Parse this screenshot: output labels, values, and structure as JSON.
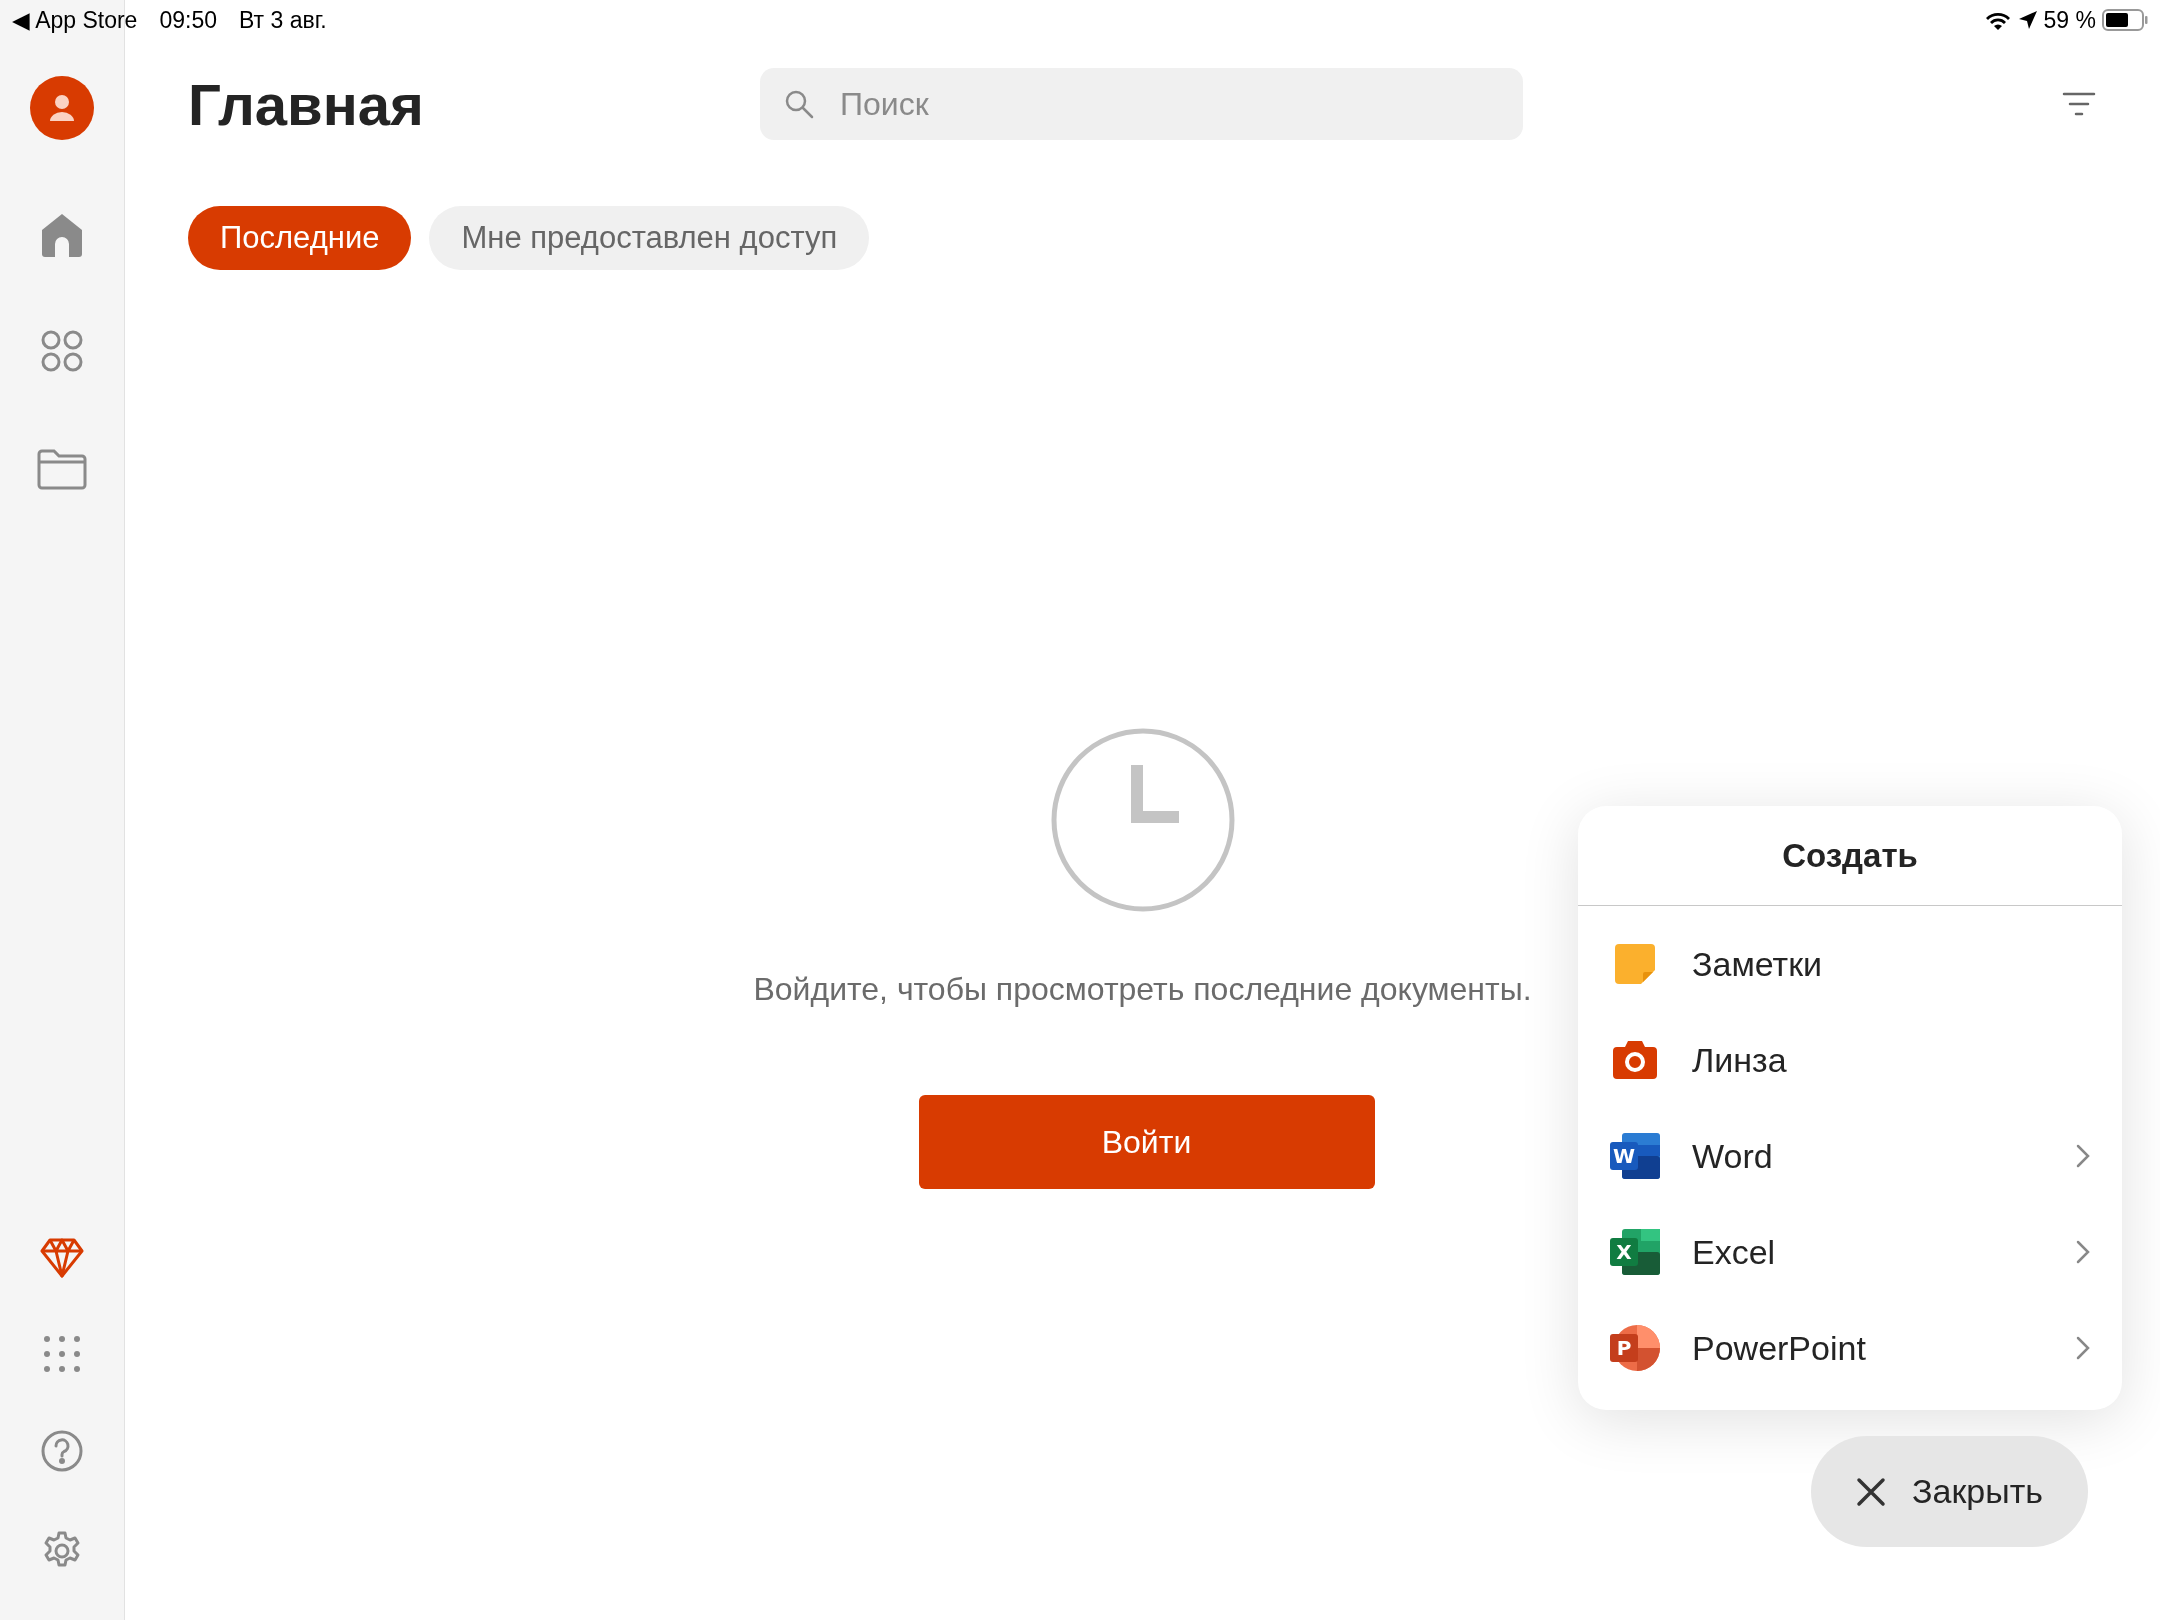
{
  "status_bar": {
    "back_arrow": "◀",
    "back_app": "App Store",
    "time": "09:50",
    "date": "Вт 3 авг.",
    "battery_percent": "59 %"
  },
  "header": {
    "title": "Главная",
    "search": {
      "placeholder": "Поиск"
    }
  },
  "tabs": [
    {
      "label": "Последние",
      "selected": true
    },
    {
      "label": "Мне предоставлен доступ",
      "selected": false
    }
  ],
  "empty_state": {
    "message": "Войдите, чтобы просмотреть последние документы.",
    "button": "Войти"
  },
  "create_menu": {
    "title": "Создать",
    "items": [
      {
        "kind": "notes",
        "label": "Заметки",
        "submenu": false
      },
      {
        "kind": "lens",
        "label": "Линза",
        "submenu": false
      },
      {
        "kind": "word",
        "icon_letter": "W",
        "label": "Word",
        "submenu": true
      },
      {
        "kind": "excel",
        "icon_letter": "X",
        "label": "Excel",
        "submenu": true
      },
      {
        "kind": "powerpoint",
        "icon_letter": "P",
        "label": "PowerPoint",
        "submenu": true
      }
    ],
    "close": "Закрыть"
  }
}
